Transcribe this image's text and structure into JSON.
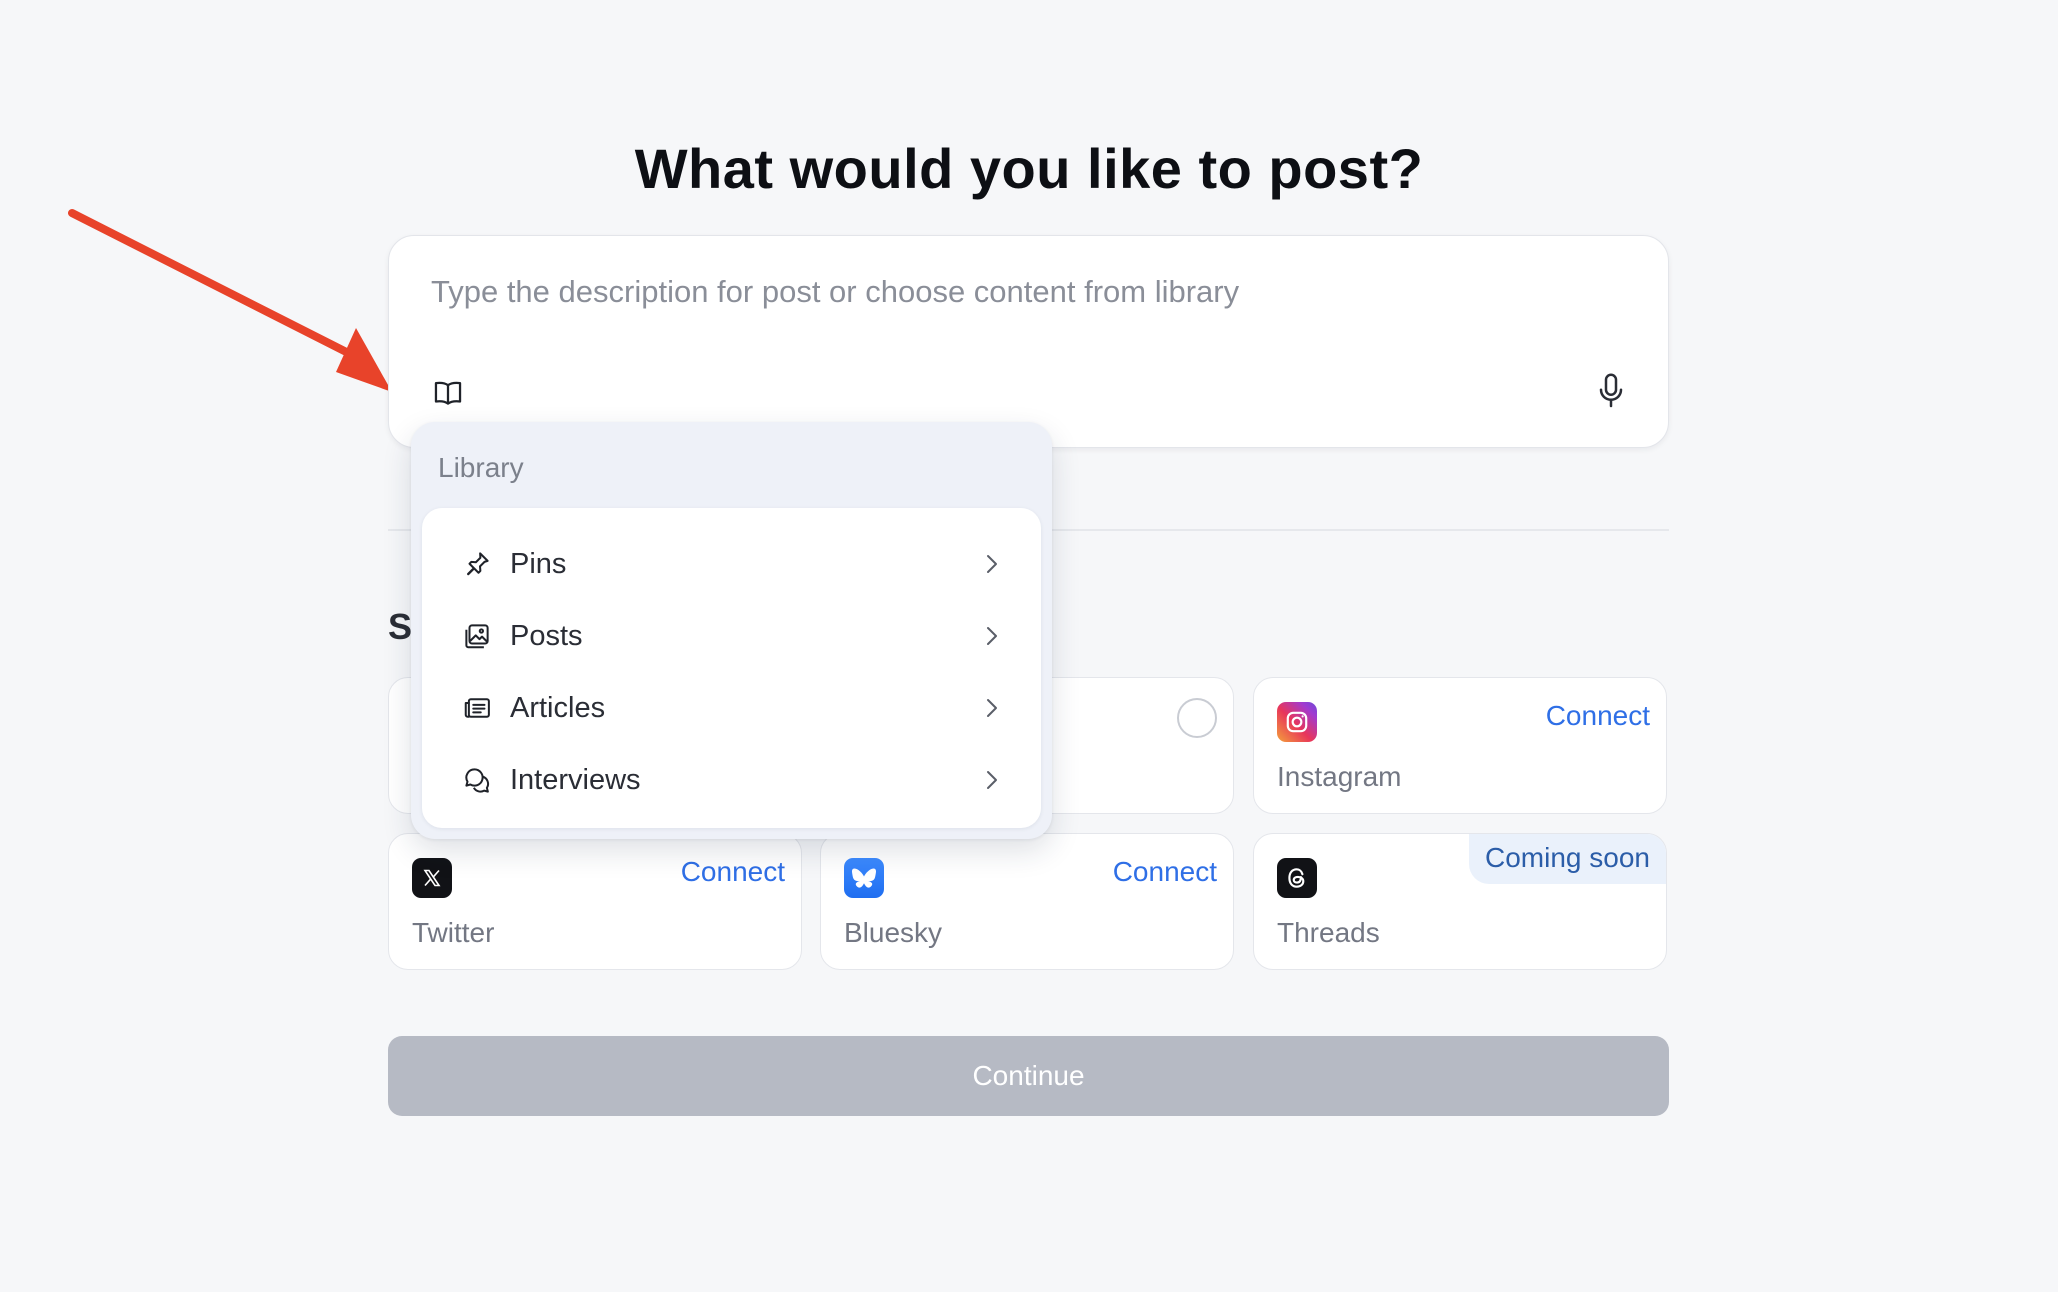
{
  "page": {
    "title": "What would you like to post?",
    "section_label": "S"
  },
  "composer": {
    "placeholder": "Type the description for post or choose content from library",
    "library_icon": "book-icon",
    "mic_icon": "microphone-icon"
  },
  "library_popup": {
    "title": "Library",
    "items": [
      {
        "label": "Pins",
        "icon": "pin-icon"
      },
      {
        "label": "Posts",
        "icon": "images-icon"
      },
      {
        "label": "Articles",
        "icon": "newspaper-icon"
      },
      {
        "label": "Interviews",
        "icon": "chat-bubbles-icon"
      }
    ]
  },
  "platforms": [
    {
      "name": "Instagram",
      "action": "Connect",
      "icon": "instagram-icon"
    },
    {
      "name": "Twitter",
      "action": "Connect",
      "icon": "x-icon"
    },
    {
      "name": "Bluesky",
      "action": "Connect",
      "icon": "bluesky-icon"
    },
    {
      "name": "Threads",
      "badge": "Coming soon",
      "icon": "threads-icon"
    }
  ],
  "continue_label": "Continue",
  "annotation": {
    "color": "#e8432a"
  }
}
